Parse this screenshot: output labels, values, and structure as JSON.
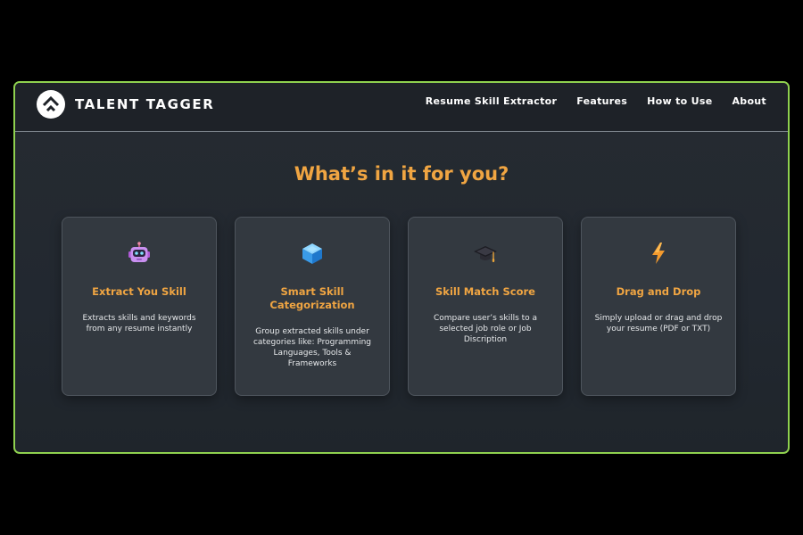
{
  "brand": {
    "name": "TALENT TAGGER",
    "logo_icon": "tag-arrow-logo-icon"
  },
  "nav": {
    "links": [
      {
        "label": "Resume Skill Extractor"
      },
      {
        "label": "Features"
      },
      {
        "label": "How to Use"
      },
      {
        "label": "About"
      }
    ]
  },
  "section": {
    "title": "What’s in it for you?"
  },
  "cards": [
    {
      "icon": "robot-icon",
      "title": "Extract You Skill",
      "description": "Extracts skills and keywords from any resume instantly"
    },
    {
      "icon": "cube-icon",
      "title": "Smart Skill Categorization",
      "description": "Group extracted skills under categories like: Programming Languages, Tools & Frameworks"
    },
    {
      "icon": "graduation-cap-icon",
      "title": "Skill Match Score",
      "description": "Compare user’s skills to a selected job role or Job Discription"
    },
    {
      "icon": "lightning-bolt-icon",
      "title": "Drag and Drop",
      "description": "Simply upload or drag and drop your resume (PDF or TXT)"
    }
  ],
  "colors": {
    "frame_border": "#8fd14f",
    "accent": "#f0a542",
    "background": "#000000",
    "navbar": "#1e2228",
    "card": "#333940"
  }
}
